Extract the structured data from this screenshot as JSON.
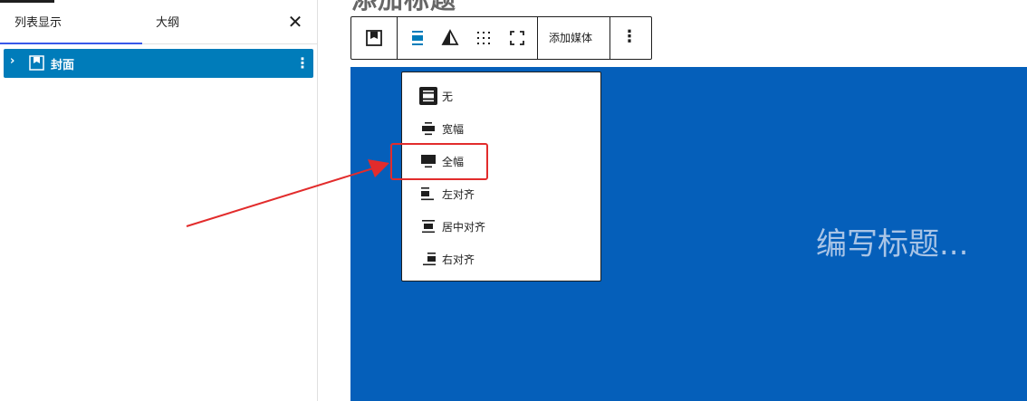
{
  "sidebar": {
    "tabs": {
      "list_view": "列表显示",
      "outline": "大纲"
    },
    "close": "✕",
    "tree": {
      "item_label": "封面"
    }
  },
  "editor": {
    "title_partial": "添加标题",
    "cover_placeholder": "编写标题...",
    "cover_color": "#055fba"
  },
  "toolbar": {
    "icons": [
      "cover-block-icon",
      "align-icon",
      "contrast-icon",
      "content-position-icon",
      "fullscreen-icon"
    ],
    "add_media_label": "添加媒体",
    "more_label": "⋮"
  },
  "align_menu": {
    "items": [
      {
        "label": "无",
        "icon": "align-none-icon"
      },
      {
        "label": "宽幅",
        "icon": "align-wide-icon"
      },
      {
        "label": "全幅",
        "icon": "align-full-icon"
      },
      {
        "label": "左对齐",
        "icon": "align-left-icon"
      },
      {
        "label": "居中对齐",
        "icon": "align-center-icon"
      },
      {
        "label": "右对齐",
        "icon": "align-right-icon"
      }
    ],
    "highlighted": "全幅"
  },
  "colors": {
    "accent": "#007cba",
    "annotation": "#e22c2c"
  }
}
